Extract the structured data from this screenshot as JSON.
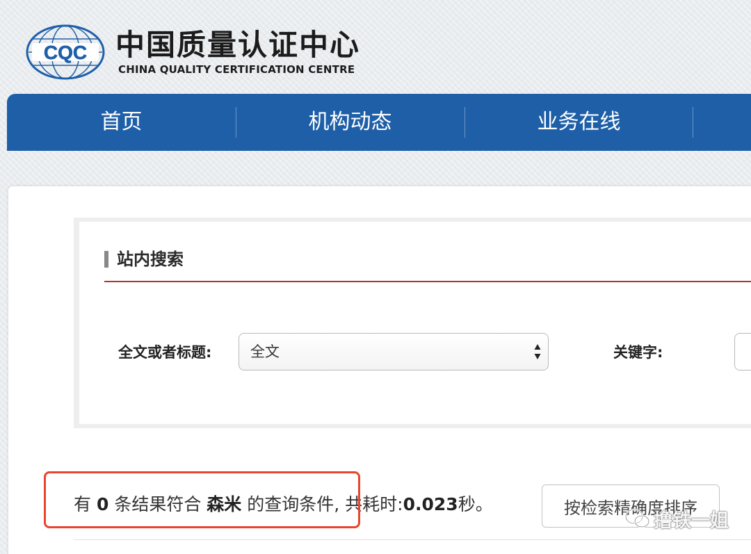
{
  "header": {
    "logo_text": "CQC",
    "title": "中国质量认证中心",
    "subtitle": "CHINA QUALITY CERTIFICATION CENTRE",
    "brand_color": "#1e5fa8"
  },
  "nav": {
    "items": [
      {
        "label": "首页"
      },
      {
        "label": "机构动态"
      },
      {
        "label": "业务在线"
      }
    ]
  },
  "search": {
    "section_title": "站内搜索",
    "scope_label": "全文或者标题:",
    "scope_selected": "全文",
    "keyword_label": "关键字:",
    "keyword_value": "",
    "accent_color": "#b8302c"
  },
  "results": {
    "prefix": "有",
    "count": "0",
    "middle": "条结果符合",
    "query": "森米",
    "suffix": "的查询条件,",
    "time_label": "共耗时:",
    "time_value": "0.023",
    "time_unit": "秒。",
    "sort_button_label": "按检索精确度排序",
    "highlight_color": "#e8452c"
  },
  "watermark": {
    "text": "撸铁一姐",
    "icon": "wechat-icon"
  }
}
